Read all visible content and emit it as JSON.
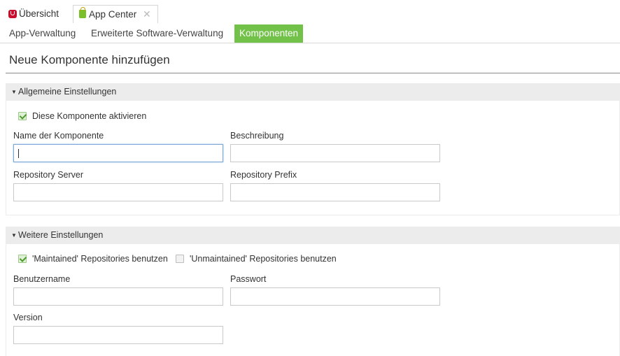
{
  "tabs": {
    "overview": "Übersicht",
    "appcenter": "App Center",
    "close_glyph": "✕"
  },
  "subnav": {
    "items": [
      "App-Verwaltung",
      "Erweiterte Software-Verwaltung",
      "Komponenten"
    ],
    "active_index": 2
  },
  "page": {
    "title": "Neue Komponente hinzufügen"
  },
  "general": {
    "header": "Allgemeine Einstellungen",
    "activate_label": "Diese Komponente aktivieren",
    "activate_checked": true,
    "name_label": "Name der Komponente",
    "name_value": "",
    "description_label": "Beschreibung",
    "description_value": "",
    "server_label": "Repository Server",
    "server_value": "",
    "prefix_label": "Repository Prefix",
    "prefix_value": ""
  },
  "more": {
    "header": "Weitere Einstellungen",
    "maintained_label": "'Maintained' Repositories benutzen",
    "maintained_checked": true,
    "unmaintained_label": "'Unmaintained' Repositories benutzen",
    "unmaintained_checked": false,
    "username_label": "Benutzername",
    "username_value": "",
    "password_label": "Passwort",
    "password_value": "",
    "version_label": "Version",
    "version_value": ""
  },
  "colors": {
    "accent": "#72c148",
    "section_header_bg": "#ececec",
    "logo_red": "#c8102e"
  }
}
